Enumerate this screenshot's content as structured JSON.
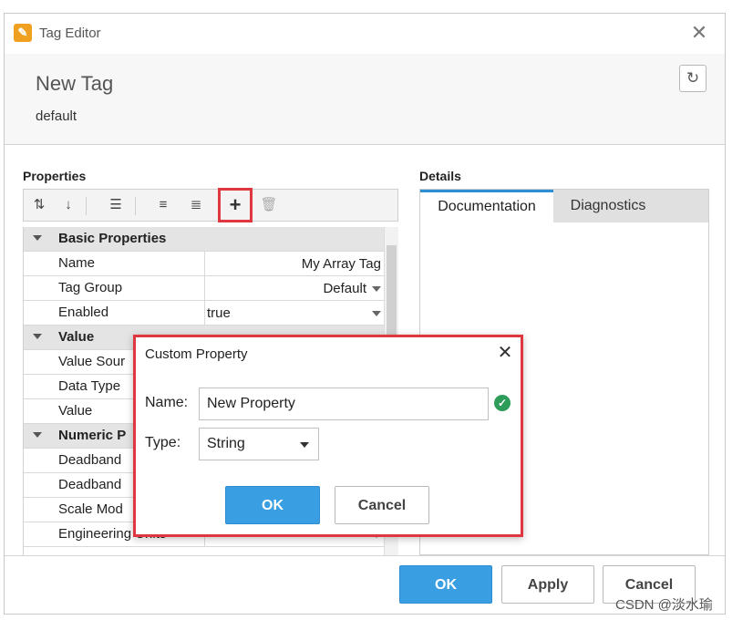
{
  "window": {
    "title": "Tag Editor",
    "app_icon": "tag-editor-icon",
    "close_icon": "close-icon"
  },
  "header": {
    "tag_name": "New Tag",
    "provider": "default",
    "refresh_icon": "refresh-icon"
  },
  "properties": {
    "label": "Properties",
    "toolbar_icons": [
      "sort-category-icon",
      "sort-alpha-icon",
      "list-icon",
      "expand-all-icon",
      "collapse-all-icon",
      "add-icon",
      "delete-icon"
    ],
    "groups": [
      {
        "label": "Basic Properties",
        "rows": [
          {
            "name": "Name",
            "value": "My Array Tag",
            "align": "right",
            "dropdown": false
          },
          {
            "name": "Tag Group",
            "value": "Default",
            "align": "right",
            "dropdown": true
          },
          {
            "name": "Enabled",
            "value": "true",
            "align": "left",
            "dropdown": true
          }
        ]
      },
      {
        "label": "Value",
        "rows": [
          {
            "name": "Value Sour",
            "value": ""
          },
          {
            "name": "Data Type",
            "value": ""
          },
          {
            "name": "Value",
            "value": ""
          }
        ]
      },
      {
        "label": "Numeric P",
        "rows": [
          {
            "name": "Deadband",
            "value": ""
          },
          {
            "name": "Deadband",
            "value": ""
          },
          {
            "name": "Scale Mod",
            "value": ""
          },
          {
            "name": "Engineering Units",
            "value": "",
            "dropdown": true
          }
        ]
      }
    ]
  },
  "details": {
    "label": "Details",
    "tabs": [
      "Documentation",
      "Diagnostics"
    ],
    "active_tab": "Documentation"
  },
  "footer": {
    "ok": "OK",
    "apply": "Apply",
    "cancel": "Cancel"
  },
  "dialog": {
    "title": "Custom Property",
    "name_label": "Name:",
    "name_value": "New Property",
    "type_label": "Type:",
    "type_value": "String",
    "ok": "OK",
    "cancel": "Cancel"
  },
  "watermark": "CSDN @淡水瑜",
  "colors": {
    "accent": "#3a9fe2",
    "highlight": "#e0363f",
    "valid": "#2e9d5a"
  }
}
